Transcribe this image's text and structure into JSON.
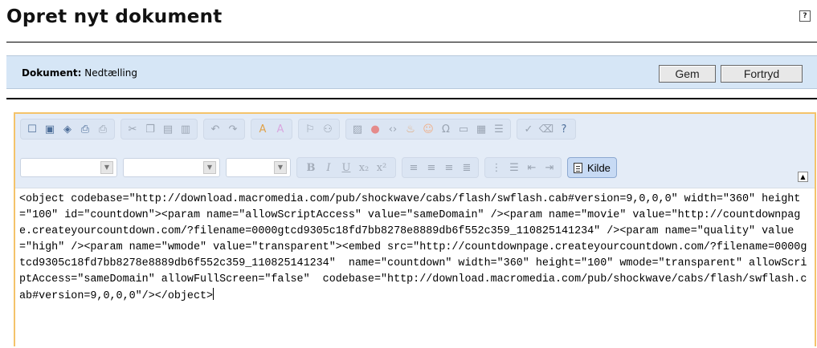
{
  "page": {
    "title": "Opret nyt dokument",
    "help": "?"
  },
  "doc_bar": {
    "label": "Dokument:",
    "name": "Nedtælling",
    "save_label": "Gem",
    "cancel_label": "Fortryd"
  },
  "toolbar": {
    "row1_groups": [
      [
        "new-page-icon",
        "save-icon",
        "template-icon",
        "preview-icon",
        "print-icon"
      ],
      [
        "cut-icon",
        "copy-icon",
        "paste-icon",
        "paste-word-icon"
      ],
      [
        "undo-icon",
        "redo-icon"
      ],
      [
        "text-color-icon",
        "background-color-icon"
      ],
      [
        "anchor-icon",
        "link-icon"
      ],
      [
        "image-icon",
        "flash-icon",
        "embed-code-icon",
        "java-icon",
        "smiley-icon",
        "special-char-icon",
        "horizontal-rule-icon",
        "table-icon",
        "page-break-icon"
      ],
      [
        "spellcheck-icon",
        "eraser-icon",
        "help-icon"
      ]
    ],
    "source_label": "Kilde"
  },
  "colors": {
    "accent_border": "#f4c36a",
    "bar_bg": "#d6e6f6",
    "toolbar_bg": "#e4ecf7"
  },
  "source_text": "<object codebase=\"http://download.macromedia.com/pub/shockwave/cabs/flash/swflash.cab#version=9,0,0,0\" width=\"360\" height=\"100\" id=\"countdown\"><param name=\"allowScriptAccess\" value=\"sameDomain\" /><param name=\"movie\" value=\"http://countdownpage.createyourcountdown.com/?filename=0000gtcd9305c18fd7bb8278e8889db6f552c359_110825141234\" /><param name=\"quality\" value=\"high\" /><param name=\"wmode\" value=\"transparent\"><embed src=\"http://countdownpage.createyourcountdown.com/?filename=0000gtcd9305c18fd7bb8278e8889db6f552c359_110825141234\"  name=\"countdown\" width=\"360\" height=\"100\" wmode=\"transparent\" allowScriptAccess=\"sameDomain\" allowFullScreen=\"false\"  codebase=\"http://download.macromedia.com/pub/shockwave/cabs/flash/swflash.cab#version=9,0,0,0\"/></object>"
}
